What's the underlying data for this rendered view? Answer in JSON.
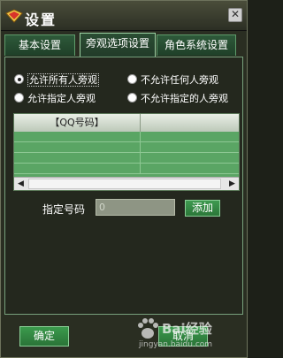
{
  "window": {
    "title": "设置"
  },
  "tabs": [
    {
      "label": "基本设置"
    },
    {
      "label": "旁观选项设置"
    },
    {
      "label": "角色系统设置"
    }
  ],
  "options": {
    "allow_all": "允许所有人旁观",
    "disallow_all": "不允许任何人旁观",
    "allow_specified": "允许指定人旁观",
    "disallow_specified": "不允许指定的人旁观",
    "selected": "allow_all"
  },
  "grid": {
    "columns": [
      "【QQ号码】",
      ""
    ],
    "rows": [
      [
        "",
        ""
      ],
      [
        "",
        ""
      ],
      [
        "",
        ""
      ],
      [
        "",
        ""
      ]
    ]
  },
  "number_field": {
    "label": "指定号码",
    "value": "0",
    "add_label": "添加"
  },
  "buttons": {
    "ok": "确定",
    "cancel": "取消"
  },
  "watermark": {
    "text": "Bai经验",
    "url": "jingyan.baidu.com"
  }
}
